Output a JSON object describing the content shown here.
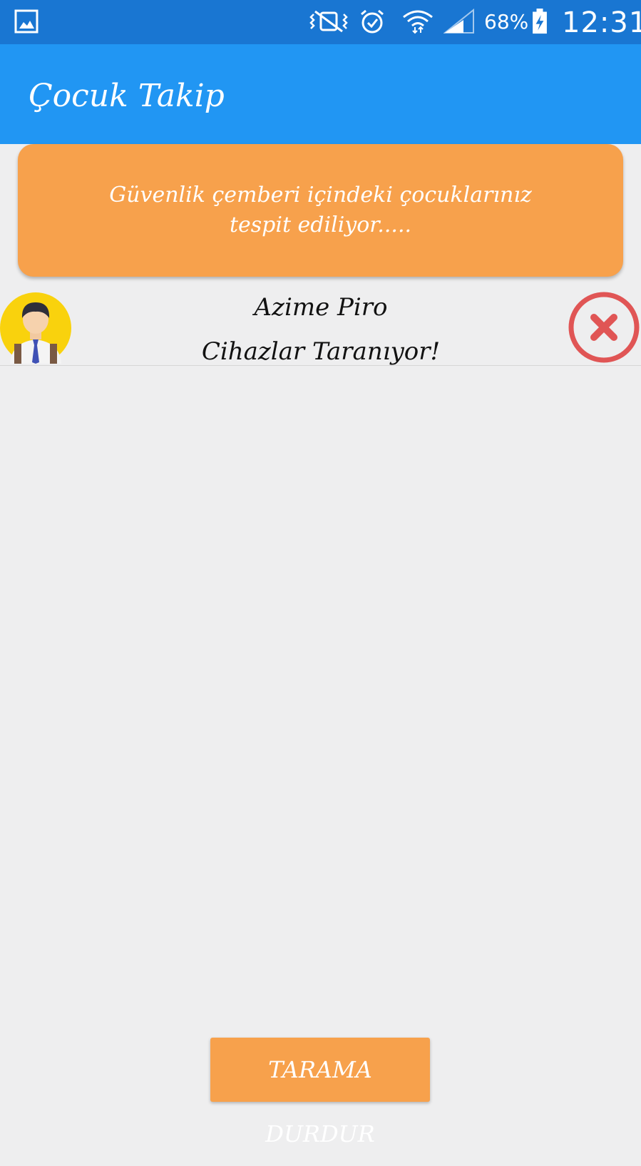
{
  "status_bar": {
    "icons": [
      "gallery-icon",
      "vibrate-icon",
      "alarm-icon",
      "wifi-icon",
      "signal-icon",
      "battery-charging-icon"
    ],
    "battery": "68%",
    "time": "12:31"
  },
  "app_bar": {
    "title": "Çocuk Takip"
  },
  "info_card": {
    "text": "Güvenlik çemberi içindeki çocuklarınız tespit ediliyor....."
  },
  "child": {
    "name": "Azime  Piro",
    "status": "Cihazlar Taranıyor!",
    "avatar_icon": "child-avatar-icon",
    "remove_icon": "close-circle-icon"
  },
  "actions": {
    "stop_label": "TARAMA DURDUR"
  },
  "colors": {
    "status_bar": "#1976d2",
    "app_bar": "#2196f3",
    "accent_orange": "#f7a14c",
    "background": "#eeeeef",
    "remove_red": "#e05555"
  }
}
